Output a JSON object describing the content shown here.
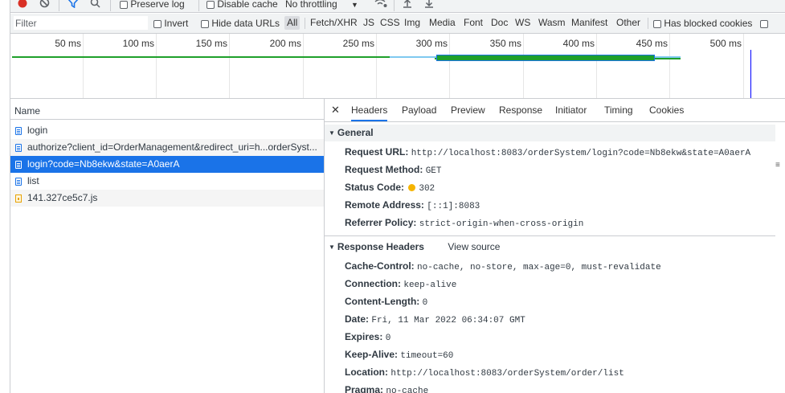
{
  "toolbar": {
    "preserve_log": "Preserve log",
    "disable_cache": "Disable cache",
    "throttling": "No throttling"
  },
  "filter": {
    "placeholder": "Filter",
    "invert": "Invert",
    "hide_data_urls": "Hide data URLs",
    "types": [
      "All",
      "Fetch/XHR",
      "JS",
      "CSS",
      "Img",
      "Media",
      "Font",
      "Doc",
      "WS",
      "Wasm",
      "Manifest",
      "Other"
    ],
    "has_blocked_cookies": "Has blocked cookies"
  },
  "overview": {
    "ticks": [
      "50 ms",
      "100 ms",
      "150 ms",
      "200 ms",
      "250 ms",
      "300 ms",
      "350 ms",
      "400 ms",
      "450 ms",
      "500 ms"
    ]
  },
  "requests": {
    "header": "Name",
    "items": [
      {
        "name": "login",
        "type": "doc"
      },
      {
        "name": "authorize?client_id=OrderManagement&redirect_uri=h...orderSyst...",
        "type": "doc"
      },
      {
        "name": "login?code=Nb8ekw&state=A0aerA",
        "type": "doc"
      },
      {
        "name": "list",
        "type": "doc"
      },
      {
        "name": "141.327ce5c7.js",
        "type": "js"
      }
    ],
    "selected_index": 2
  },
  "detail": {
    "tabs": [
      "Headers",
      "Payload",
      "Preview",
      "Response",
      "Initiator",
      "Timing",
      "Cookies"
    ],
    "active_tab": "Headers",
    "general": {
      "title": "General",
      "request_url_label": "Request URL:",
      "request_url": "http://localhost:8083/orderSystem/login?code=Nb8ekw&state=A0aerA",
      "request_method_label": "Request Method:",
      "request_method": "GET",
      "status_code_label": "Status Code:",
      "status_code": "302",
      "remote_address_label": "Remote Address:",
      "remote_address": "[::1]:8083",
      "referrer_policy_label": "Referrer Policy:",
      "referrer_policy": "strict-origin-when-cross-origin"
    },
    "response_headers": {
      "title": "Response Headers",
      "view_source": "View source",
      "items": [
        {
          "key": "Cache-Control:",
          "value": "no-cache, no-store, max-age=0, must-revalidate"
        },
        {
          "key": "Connection:",
          "value": "keep-alive"
        },
        {
          "key": "Content-Length:",
          "value": "0"
        },
        {
          "key": "Date:",
          "value": "Fri, 11 Mar 2022 06:34:07 GMT"
        },
        {
          "key": "Expires:",
          "value": "0"
        },
        {
          "key": "Keep-Alive:",
          "value": "timeout=60"
        },
        {
          "key": "Location:",
          "value": "http://localhost:8083/orderSystem/order/list"
        },
        {
          "key": "Pragma:",
          "value": "no-cache"
        }
      ]
    }
  },
  "colors": {
    "accent": "#1a73e8",
    "status_warning": "#f5b400",
    "timeline_green": "#1fa02b",
    "record_red": "#d93025"
  }
}
